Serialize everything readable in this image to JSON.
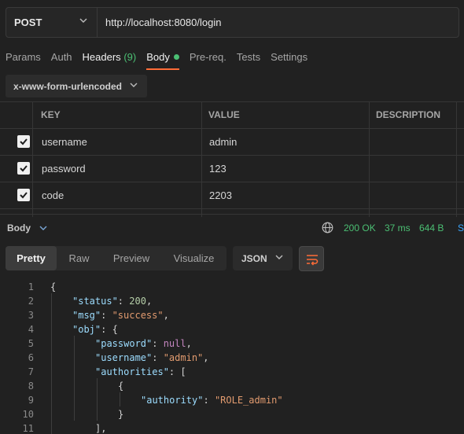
{
  "request": {
    "method": "POST",
    "url": "http://localhost:8080/login"
  },
  "tabs": [
    {
      "label": "Params"
    },
    {
      "label": "Auth"
    },
    {
      "label": "Headers",
      "count": "(9)"
    },
    {
      "label": "Body"
    },
    {
      "label": "Pre-req."
    },
    {
      "label": "Tests"
    },
    {
      "label": "Settings"
    }
  ],
  "body_type": "x-www-form-urlencoded",
  "table": {
    "headers": [
      "KEY",
      "VALUE",
      "DESCRIPTION"
    ],
    "rows": [
      {
        "checked": true,
        "key": "username",
        "value": "admin",
        "description": ""
      },
      {
        "checked": true,
        "key": "password",
        "value": "123",
        "description": ""
      },
      {
        "checked": true,
        "key": "code",
        "value": "2203",
        "description": ""
      }
    ]
  },
  "response": {
    "label": "Body",
    "status": "200 OK",
    "time": "37 ms",
    "size": "644 B",
    "truncated_action": "S"
  },
  "view_tabs": [
    "Pretty",
    "Raw",
    "Preview",
    "Visualize"
  ],
  "format": "JSON",
  "code_lines": [
    {
      "n": "1",
      "text": "{"
    },
    {
      "n": "2",
      "text": "\"status\": 200,"
    },
    {
      "n": "3",
      "text": "\"msg\": \"success\","
    },
    {
      "n": "4",
      "text": "\"obj\": {"
    },
    {
      "n": "5",
      "text": "\"password\": null,"
    },
    {
      "n": "6",
      "text": "\"username\": \"admin\","
    },
    {
      "n": "7",
      "text": "\"authorities\": ["
    },
    {
      "n": "8",
      "text": "{"
    },
    {
      "n": "9",
      "text": "\"authority\": \"ROLE_admin\""
    },
    {
      "n": "10",
      "text": "}"
    },
    {
      "n": "11",
      "text": "],"
    }
  ],
  "colors": {
    "accent": "#ff6c37",
    "success": "#4bbf73",
    "link": "#3aa6ff"
  },
  "icons": {
    "method_dropdown": "chevron-down-icon",
    "body_type_dropdown": "chevron-down-icon",
    "response_collapse": "chevron-down-icon",
    "network": "globe-icon",
    "format_dropdown": "chevron-down-icon",
    "wrap": "wrap-lines-icon",
    "row_checkbox": "checkbox-checked-icon"
  }
}
